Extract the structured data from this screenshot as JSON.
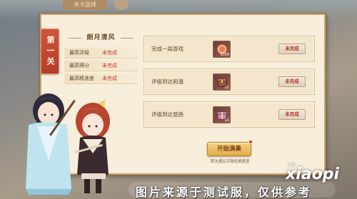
{
  "top": {
    "tag": "关卡选择"
  },
  "stage": {
    "badge": "第一关"
  },
  "left_card": {
    "title": "朗月清风",
    "stats": [
      {
        "label": "最高评级",
        "value": "未完成"
      },
      {
        "label": "最高得分",
        "value": "未完成"
      },
      {
        "label": "最高精准度",
        "value": "未完成"
      }
    ]
  },
  "quests": [
    {
      "text": "完成一局游戏",
      "reward_icon": "coin-pouch-icon",
      "reward_count": "5000",
      "status": "未完成"
    },
    {
      "text": "评级到达和谐",
      "reward_icon": "treasure-chest-icon",
      "reward_count": "x1",
      "status": "未完成"
    },
    {
      "text": "评级到达悠扬",
      "reward_icon": "gift-box-icon",
      "reward_count": "x1",
      "status": "未完成"
    }
  ],
  "start_button": {
    "label": "开始演奏"
  },
  "hint": "首次通关可降低难度度",
  "watermark": {
    "text": "图片来源于测试服，仅供参考",
    "logo": "xiaopi",
    "logo_sub": "小皮"
  },
  "colors": {
    "panel_bg": "#f7eedb",
    "accent_red": "#c0392b",
    "badge_red": "#b33c28",
    "gold": "#e3ac48"
  }
}
